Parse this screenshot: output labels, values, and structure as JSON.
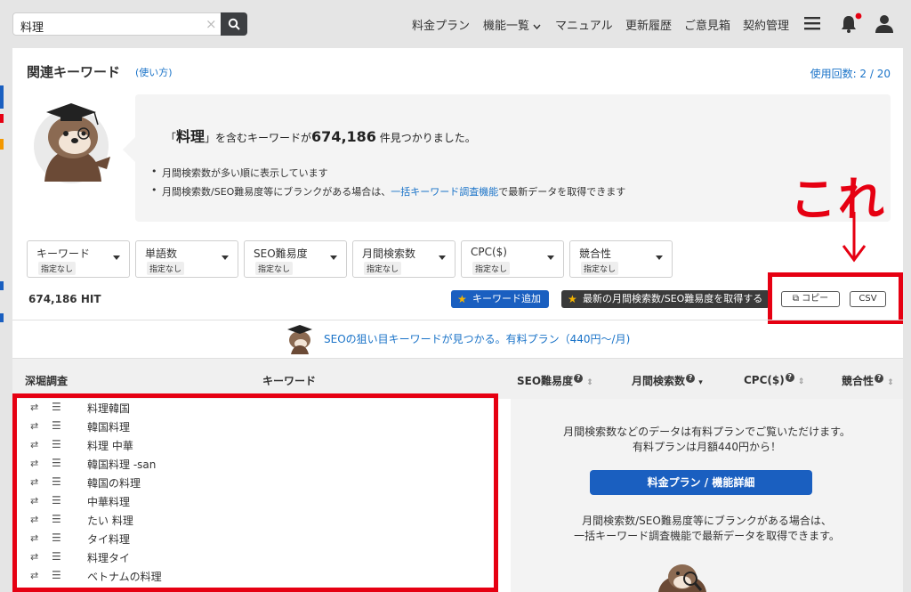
{
  "search": {
    "value": "料理",
    "clear": "×"
  },
  "nav": {
    "plans": "料金プラン",
    "features": "機能一覧",
    "manual": "マニュアル",
    "history": "更新履歴",
    "feedback": "ご意見箱",
    "contract": "契約管理"
  },
  "header": {
    "title": "関連キーワード",
    "howto": "(使い方)",
    "usage": "使用回数: 2 / 20"
  },
  "info": {
    "pre": "「",
    "keyword": "料理",
    "mid": "」を含むキーワードが",
    "count": "674,186",
    "post": " 件見つかりました。",
    "bullet1": "月間検索数が多い順に表示しています",
    "bullet2_pre": "月間検索数/SEO難易度等にブランクがある場合は、",
    "bullet2_link": "一括キーワード調査機能",
    "bullet2_post": "で最新データを取得できます"
  },
  "annotation": {
    "label": "これ",
    "arrow": "↓"
  },
  "filters": [
    {
      "label": "キーワード",
      "sub": "指定なし"
    },
    {
      "label": "単語数",
      "sub": "指定なし"
    },
    {
      "label": "SEO難易度",
      "sub": "指定なし"
    },
    {
      "label": "月間検索数",
      "sub": "指定なし"
    },
    {
      "label": "CPC($)",
      "sub": "指定なし"
    },
    {
      "label": "競合性",
      "sub": "指定なし"
    }
  ],
  "results": {
    "hit": "674,186 HIT",
    "add_keyword": "キーワード追加",
    "fetch_latest": "最新の月間検索数/SEO難易度を取得する",
    "copy": "コピー",
    "csv": "CSV"
  },
  "promo": {
    "text": "SEOの狙い目キーワードが見つかる。有料プラン（440円〜/月)"
  },
  "table": {
    "columns": [
      "深堀調査",
      "キーワード",
      "SEO難易度",
      "月間検索数",
      "CPC($)",
      "競合性"
    ],
    "q": "?",
    "sort_both": "⇕",
    "sort_down": "▾",
    "rows": [
      "料理韓国",
      "韓国料理",
      "料理 中華",
      "韓国料理 -san",
      "韓国の料理",
      "中華料理",
      "たい 料理",
      "タイ料理",
      "料理タイ",
      "ベトナムの料理"
    ]
  },
  "paid": {
    "line1": "月間検索数などのデータは有料プランでご覧いただけます。",
    "line2": "有料プランは月額440円から！",
    "button": "料金プラン / 機能詳細",
    "line3": "月間検索数/SEO難易度等にブランクがある場合は、",
    "line4": "一括キーワード調査機能で最新データを取得できます。"
  },
  "colors": {
    "accent": "#1a73c8",
    "button": "#1a5fc0",
    "annotation": "#e60012"
  }
}
